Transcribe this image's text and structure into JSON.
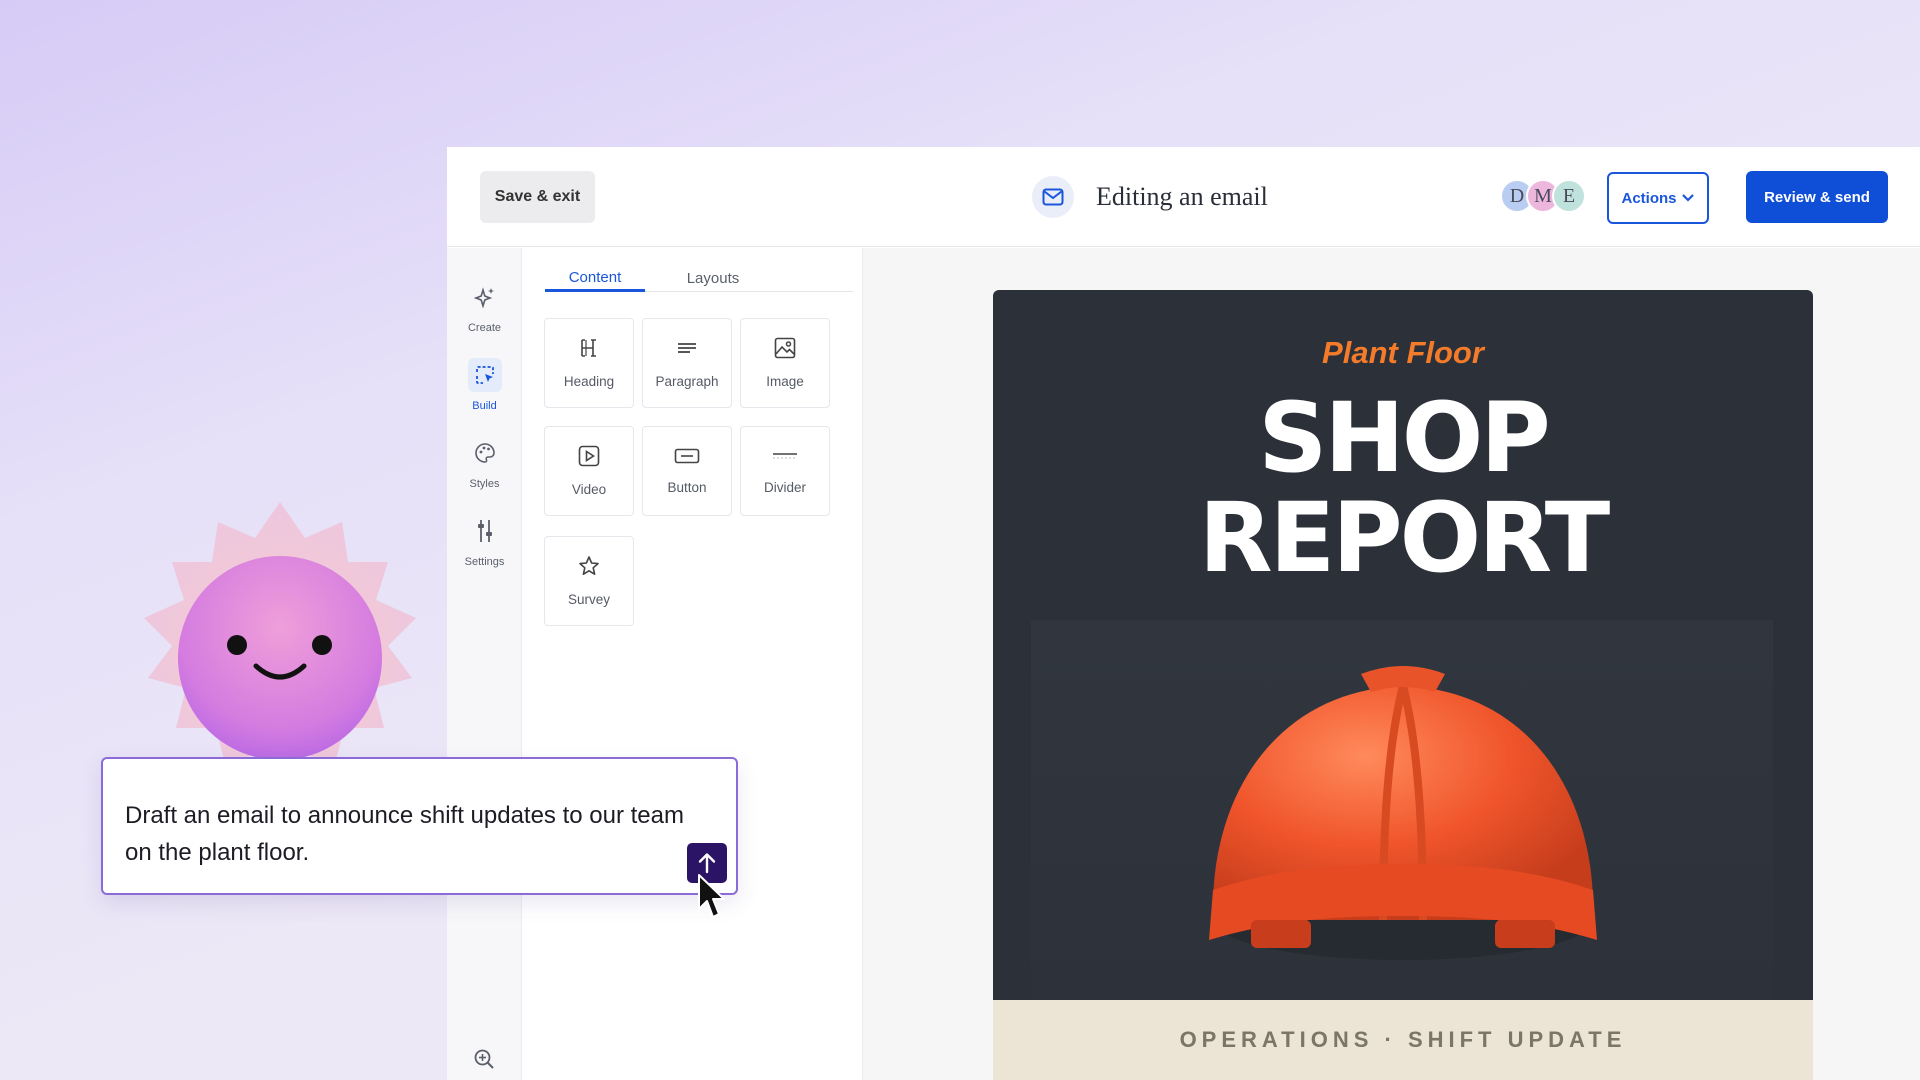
{
  "topbar": {
    "save_exit_label": "Save & exit",
    "page_title": "Editing an email",
    "avatars": [
      {
        "initial": "D",
        "color": "#b9cdf2"
      },
      {
        "initial": "M",
        "color": "#ecb6dd"
      },
      {
        "initial": "E",
        "color": "#bfe3dc"
      }
    ],
    "actions_label": "Actions",
    "review_send_label": "Review & send",
    "accent_color": "#1a56db"
  },
  "rail": {
    "items": [
      {
        "label": "Create",
        "icon": "sparkle-icon"
      },
      {
        "label": "Build",
        "icon": "build-icon",
        "active": true
      },
      {
        "label": "Styles",
        "icon": "palette-icon"
      },
      {
        "label": "Settings",
        "icon": "sliders-icon"
      }
    ],
    "zoom_icon": "zoom-in-icon"
  },
  "panel": {
    "tabs": [
      {
        "label": "Content",
        "active": true
      },
      {
        "label": "Layouts",
        "active": false
      }
    ],
    "blocks": [
      {
        "label": "Heading",
        "icon": "heading-icon"
      },
      {
        "label": "Paragraph",
        "icon": "paragraph-icon"
      },
      {
        "label": "Image",
        "icon": "image-icon"
      },
      {
        "label": "Video",
        "icon": "video-icon"
      },
      {
        "label": "Button",
        "icon": "button-icon"
      },
      {
        "label": "Divider",
        "icon": "divider-icon"
      },
      {
        "label": "Survey",
        "icon": "star-icon"
      }
    ]
  },
  "email": {
    "kicker": "Plant Floor",
    "headline_line1": "SHOP",
    "headline_line2": "REPORT",
    "footer": "OPERATIONS · SHIFT UPDATE",
    "kicker_color": "#f47b2a",
    "background_color": "#2c3139"
  },
  "prompt": {
    "text": "Draft an email to announce shift updates to our team on the plant floor."
  }
}
